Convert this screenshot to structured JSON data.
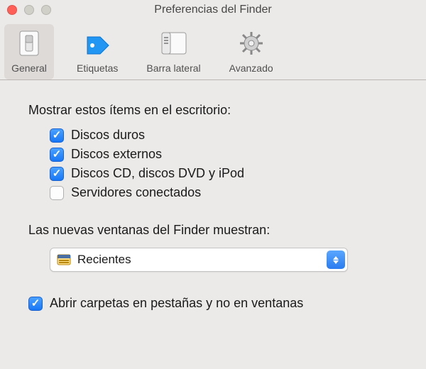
{
  "window": {
    "title": "Preferencias del Finder"
  },
  "tabs": [
    {
      "label": "General"
    },
    {
      "label": "Etiquetas"
    },
    {
      "label": "Barra lateral"
    },
    {
      "label": "Avanzado"
    }
  ],
  "section1": {
    "label": "Mostrar estos ítems en el escritorio:"
  },
  "checks": [
    {
      "label": "Discos duros",
      "checked": true
    },
    {
      "label": "Discos externos",
      "checked": true
    },
    {
      "label": "Discos CD, discos DVD y iPod",
      "checked": true
    },
    {
      "label": "Servidores conectados",
      "checked": false
    }
  ],
  "section2": {
    "label": "Las nuevas ventanas del Finder muestran:"
  },
  "dropdown": {
    "value": "Recientes"
  },
  "bottom": {
    "label": "Abrir carpetas en pestañas y no en ventanas",
    "checked": true
  }
}
